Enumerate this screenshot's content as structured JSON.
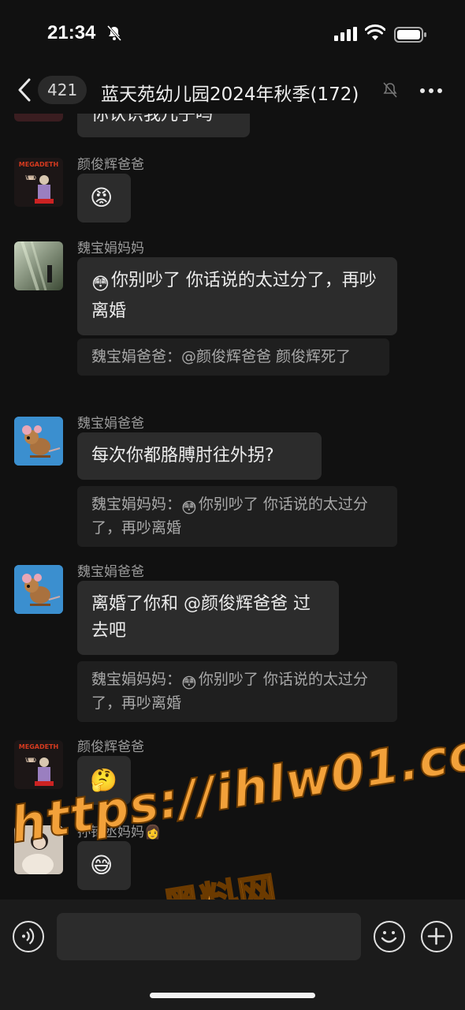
{
  "status_bar": {
    "time": "21:34"
  },
  "nav": {
    "unread_count": "421",
    "title": "蓝天苑幼儿园2024年秋季",
    "member_count": "(172)"
  },
  "messages": [
    {
      "type": "text",
      "sender": "",
      "text": "你认识我儿子吗"
    },
    {
      "type": "emoji",
      "sender": "颜俊辉爸爸",
      "emoji": "😡"
    },
    {
      "type": "text",
      "sender": "魏宝娟妈妈",
      "emoji": "😳",
      "text": "你别吵了 你话说的太过分了，再吵离婚",
      "quote": "魏宝娟爸爸：@颜俊辉爸爸  颜俊辉死了"
    },
    {
      "type": "text",
      "sender": "魏宝娟爸爸",
      "text": "每次你都胳膊肘往外拐?",
      "quote_emoji": "😳",
      "quote_prefix": "魏宝娟妈妈：",
      "quote_text": "你别吵了 你话说的太过分了，再吵离婚"
    },
    {
      "type": "text",
      "sender": "魏宝娟爸爸",
      "text": "离婚了你和 @颜俊辉爸爸 过去吧",
      "quote_emoji": "😳",
      "quote_prefix": "魏宝娟妈妈：",
      "quote_text": "你别吵了 你话说的太过分了，再吵离婚"
    },
    {
      "type": "emoji",
      "sender": "颜俊辉爸爸",
      "emoji": "🤔"
    },
    {
      "type": "emoji",
      "sender": "孙锜丞妈妈👩",
      "emoji": "😅"
    }
  ],
  "avatars": {
    "megadeth_logo": "MEGADETH",
    "megadeth_album": "WAKE UP DEAD"
  },
  "watermark": {
    "url": "https://ihlw01.com",
    "name": "黑料网"
  },
  "colors": {
    "background": "#111111",
    "bubble": "#2c2c2c",
    "quote": "#1f1f1f",
    "watermark": "#f2a13a"
  }
}
